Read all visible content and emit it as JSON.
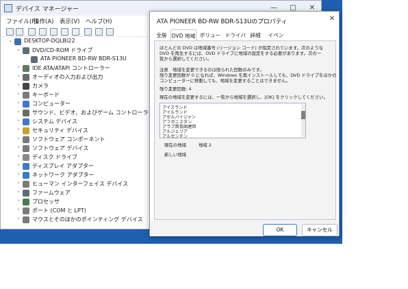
{
  "device_manager": {
    "title": "デバイス マネージャー",
    "controls": {
      "minimize": "—",
      "maximize": "□",
      "close": "✕"
    },
    "menu": [
      "ファイル(F)",
      "操作(A)",
      "表示(V)",
      "ヘルプ(H)"
    ],
    "toolbar_icons": [
      "back-icon",
      "forward-icon",
      "show-hidden-icon",
      "properties-icon",
      "help-icon",
      "update-driver-icon",
      "computer-icon",
      "disable-icon",
      "uninstall-icon",
      "scan-icon"
    ],
    "tree": [
      {
        "label": "DESKTOP-DQLBI22",
        "expander": "⌄",
        "icon": "computer-icon",
        "color": "#3d6fb0"
      },
      {
        "label": "DVD/CD-ROM ドライブ",
        "expander": "⌄",
        "icon": "dvd-drive-icon",
        "color": "#5f6b7a"
      },
      {
        "label": "ATA PIONEER BD-RW   BDR-S13U",
        "expander": "",
        "icon": "dvd-device-icon",
        "color": "#5f6b7a"
      },
      {
        "label": "IDE ATA/ATAPI コントローラー",
        "expander": "›",
        "icon": "ide-controller-icon",
        "color": "#5f7a60"
      },
      {
        "label": "オーディオの入力および出力",
        "expander": "›",
        "icon": "speaker-icon",
        "color": "#6a6a6a"
      },
      {
        "label": "カメラ",
        "expander": "›",
        "icon": "camera-icon",
        "color": "#444444"
      },
      {
        "label": "キーボード",
        "expander": "›",
        "icon": "keyboard-icon",
        "color": "#7a7a7a"
      },
      {
        "label": "コンピューター",
        "expander": "›",
        "icon": "computer-icon",
        "color": "#3d7ac7"
      },
      {
        "label": "サウンド、ビデオ、およびゲーム コントローラー",
        "expander": "›",
        "icon": "sound-icon",
        "color": "#6a6a6a"
      },
      {
        "label": "システム デバイス",
        "expander": "›",
        "icon": "system-device-icon",
        "color": "#3d7ac7"
      },
      {
        "label": "セキュリティ デバイス",
        "expander": "›",
        "icon": "security-icon",
        "color": "#c9a227"
      },
      {
        "label": "ソフトウェア コンポーネント",
        "expander": "›",
        "icon": "software-component-icon",
        "color": "#7a7a7a"
      },
      {
        "label": "ソフトウェア デバイス",
        "expander": "›",
        "icon": "software-device-icon",
        "color": "#7a7a7a"
      },
      {
        "label": "ディスク ドライブ",
        "expander": "›",
        "icon": "disk-drive-icon",
        "color": "#8a8a8a"
      },
      {
        "label": "ディスプレイ アダプター",
        "expander": "›",
        "icon": "display-adapter-icon",
        "color": "#3d7ac7"
      },
      {
        "label": "ネットワーク アダプター",
        "expander": "›",
        "icon": "network-icon",
        "color": "#3d7ac7"
      },
      {
        "label": "ヒューマン インターフェイス デバイス",
        "expander": "›",
        "icon": "hid-icon",
        "color": "#7a7a7a"
      },
      {
        "label": "ファームウェア",
        "expander": "›",
        "icon": "firmware-icon",
        "color": "#5f6b7a"
      },
      {
        "label": "プロセッサ",
        "expander": "›",
        "icon": "processor-icon",
        "color": "#4f7a4f"
      },
      {
        "label": "ポート (COM と LPT)",
        "expander": "›",
        "icon": "port-icon",
        "color": "#7a7a7a"
      },
      {
        "label": "マウスとそのほかのポインティング デバイス",
        "expander": "›",
        "icon": "mouse-icon",
        "color": "#7a7a7a"
      }
    ]
  },
  "properties_dialog": {
    "title": "ATA PIONEER BD-RW   BDR-S13Uのプロパティ",
    "close": "✕",
    "tabs": [
      "全般",
      "DVD 地域",
      "ボリューム",
      "ドライバー",
      "詳細",
      "イベント"
    ],
    "active_tab": "DVD 地域",
    "intro_lines": [
      "ほとんどの DVD は地域番号 (リージョン コード) が指定されています。次のような",
      "DVD を再生するには、DVD ドライブに地域の設定をする必要があります。次の一",
      "覧から選択してください。"
    ],
    "note_lines": [
      "注意　地域を変更できるのは限られた回数のみです。",
      "残り変更回数が 0 になれば、Windows を再インストールしても、DVD ドライブをほかの",
      "コンピューターに移動しても、地域を変更することはできません。"
    ],
    "remaining_changes": "残り変更回数: 4",
    "instruction": "現在の地域を変更するには、一覧から地域を選択し、[OK] をクリックしてください。",
    "regions": [
      "アイスランド",
      "アイルランド",
      "アゼルバイジャン",
      "アフガニスタン",
      "アラブ首長国連邦",
      "アルジェリア",
      "アルゼンチン"
    ],
    "current_region_label": "現在の地域",
    "current_region_value": "地域 2",
    "new_region_label": "新しい地域",
    "ok": "OK",
    "cancel": "キャンセル"
  }
}
